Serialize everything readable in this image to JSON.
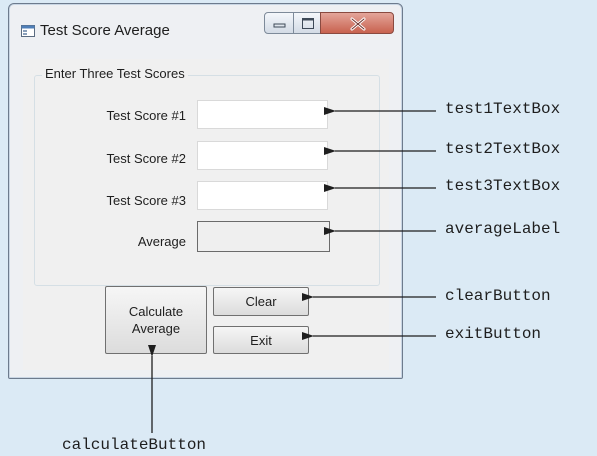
{
  "window": {
    "title": "Test Score Average",
    "controls": [
      "minimize-icon",
      "maximize-icon",
      "close-icon"
    ]
  },
  "group": {
    "label": "Enter Three Test Scores",
    "fields": [
      {
        "label": "Test Score #1",
        "value": ""
      },
      {
        "label": "Test Score #2",
        "value": ""
      },
      {
        "label": "Test Score #3",
        "value": ""
      }
    ],
    "average_label": "Average",
    "average_value": ""
  },
  "buttons": {
    "calculate_line1": "Calculate",
    "calculate_line2": "Average",
    "clear": "Clear",
    "exit": "Exit"
  },
  "callouts": {
    "test1": "test1TextBox",
    "test2": "test2TextBox",
    "test3": "test3TextBox",
    "average": "averageLabel",
    "clear": "clearButton",
    "exit": "exitButton",
    "calculate": "calculateButton"
  },
  "colors": {
    "background": "#dbeaf5",
    "window_border": "#6d7b8d",
    "close_button": "#c8624f"
  }
}
